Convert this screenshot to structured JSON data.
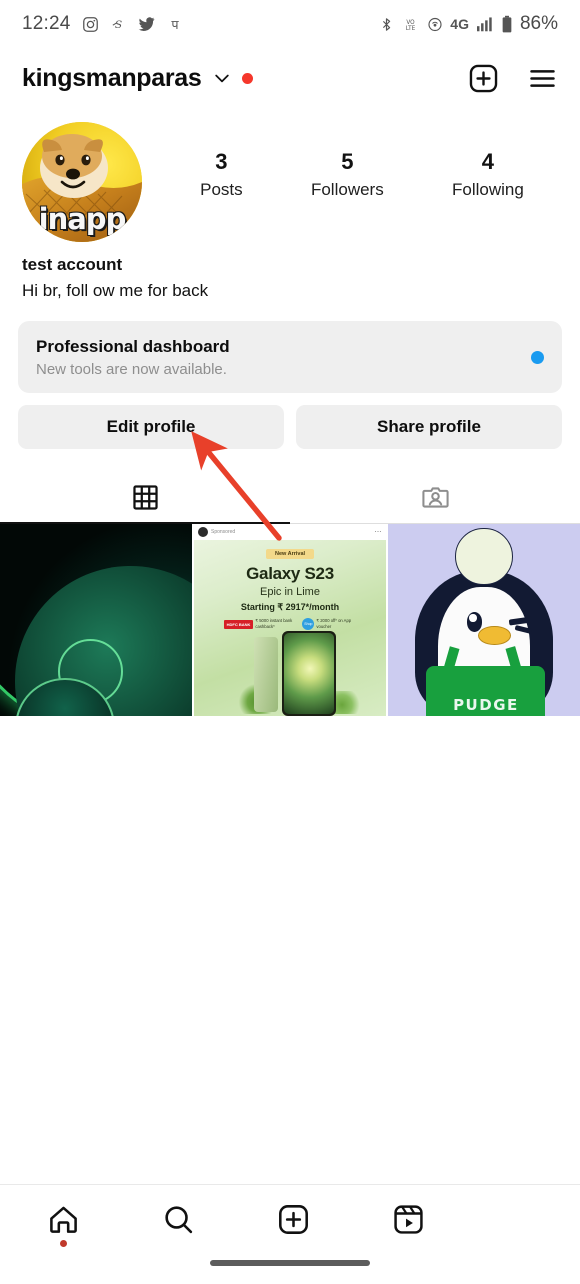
{
  "status_bar": {
    "time": "12:24",
    "left_icons": [
      "instagram-icon",
      "snapchat-icon",
      "twitter-icon",
      "phonepe-icon"
    ],
    "right_icons": [
      "bluetooth-icon",
      "volte-icon",
      "hotspot-icon",
      "signal-bars-icon",
      "battery-icon"
    ],
    "network": "4G",
    "battery": "86%"
  },
  "header": {
    "username": "kingsmanparas",
    "chevron": "chevron-down-icon",
    "badge_color": "#f5372b",
    "create_icon": "plus-box-icon",
    "menu_icon": "hamburger-menu-icon"
  },
  "profile": {
    "avatar_alt": "doge-pineapple-avatar",
    "avatar_watermark": "inapp",
    "display_name": "test account",
    "bio": "Hi br, foll ow me for back",
    "stats": [
      {
        "value": "3",
        "label": "Posts"
      },
      {
        "value": "5",
        "label": "Followers"
      },
      {
        "value": "4",
        "label": "Following"
      }
    ]
  },
  "dashboard": {
    "title": "Professional dashboard",
    "subtitle": "New tools are now available.",
    "dot_color": "#1a9bf0"
  },
  "actions": {
    "edit_profile": "Edit profile",
    "share_profile": "Share profile"
  },
  "tabs": [
    {
      "name": "grid-tab",
      "icon": "grid-icon",
      "active": true
    },
    {
      "name": "tagged-tab",
      "icon": "tagged-person-icon",
      "active": false
    }
  ],
  "posts": [
    {
      "id": "post-1",
      "alt": "dark-green-abstract-wallpaper"
    },
    {
      "id": "post-2",
      "alt": "galaxy-s23-sponsored-ad",
      "sponsored_label": "Sponsored",
      "more_icon": "more-options-icon",
      "badge": "New Arrival",
      "title": "Galaxy S23",
      "subtitle": "Epic in Lime",
      "price": "Starting ₹ 2917*/month",
      "offer_bank": "HDFC BANK",
      "offer_bank_text": "₹ 5000 instant bank cashback*",
      "offer_voucher_text": "₹ 2000 off* on App voucher",
      "voucher_badge": "Shop"
    },
    {
      "id": "post-3",
      "alt": "pudge-penguin-nft",
      "apron_text": "PUDGE"
    }
  ],
  "bottom_nav": [
    {
      "name": "nav-home",
      "icon": "home-icon",
      "badge": true
    },
    {
      "name": "nav-search",
      "icon": "search-icon",
      "badge": false
    },
    {
      "name": "nav-create",
      "icon": "plus-box-icon",
      "badge": false
    },
    {
      "name": "nav-reels",
      "icon": "reels-icon",
      "badge": false
    }
  ],
  "annotation": {
    "type": "arrow",
    "color": "#e8402a",
    "points_to": "Edit profile"
  }
}
